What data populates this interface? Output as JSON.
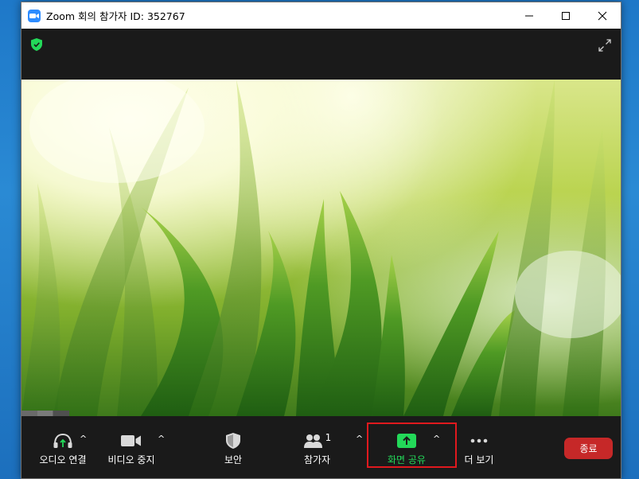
{
  "window": {
    "title": "Zoom 회의 참가자 ID: 352767"
  },
  "toolbar": {
    "audio_label": "오디오 연결",
    "video_label": "비디오 중지",
    "security_label": "보안",
    "participants_label": "참가자",
    "participants_count": "1",
    "share_label": "화면 공유",
    "more_label": "더 보기",
    "end_label": "종료",
    "caret": "^"
  },
  "colors": {
    "accent_green": "#23d959",
    "end_red": "#c62828",
    "highlight_red": "#e0191e",
    "zoom_blue": "#2d8cff"
  }
}
